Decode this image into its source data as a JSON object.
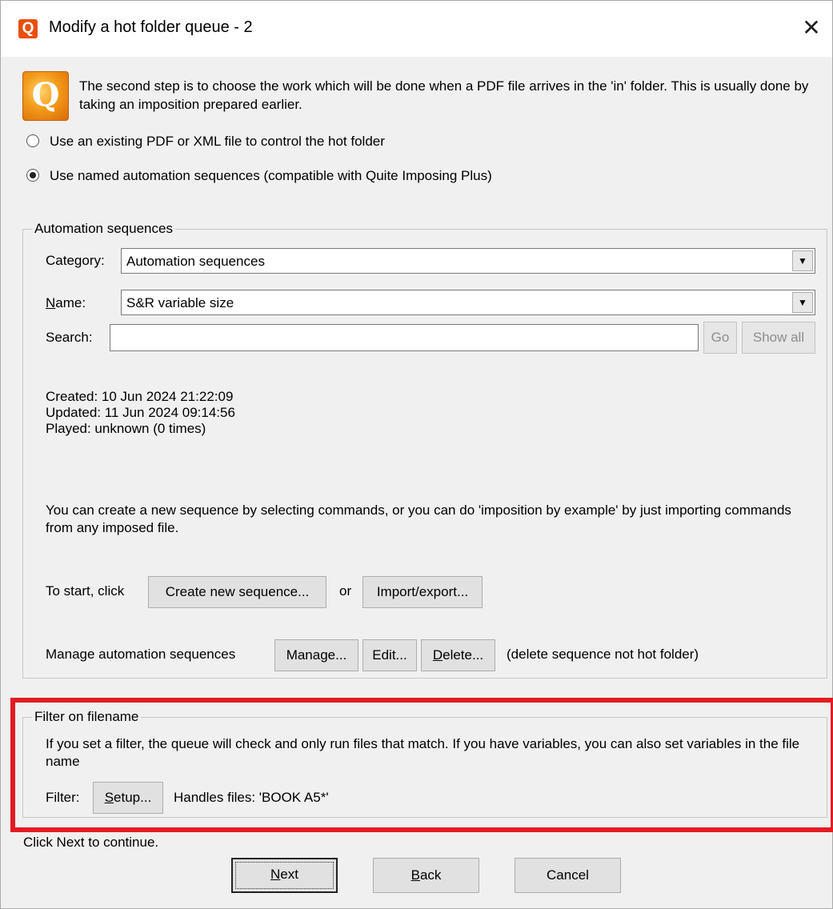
{
  "window": {
    "title": "Modify a hot folder queue - 2",
    "close_glyph": "✕",
    "app_icon_letter": "Q"
  },
  "intro": {
    "big_icon_letter": "Q",
    "text": "The second step is to choose the work which will be done when a PDF file arrives in the 'in' folder. This is usually done by taking an imposition prepared earlier."
  },
  "options": {
    "existing_file": "Use an existing PDF or XML file to control the hot folder",
    "named_sequences": "Use named automation sequences (compatible with Quite Imposing Plus)",
    "selected": "named_sequences"
  },
  "automation": {
    "group_title": "Automation sequences",
    "category_label": "Category:",
    "category_value": "Automation sequences",
    "name_label_first": "N",
    "name_label_rest": "ame:",
    "name_value": "S&R variable size",
    "search_label": "Search:",
    "search_value": "",
    "go_button": "Go",
    "show_all_button": "Show all",
    "created": "Created: 10 Jun 2024 21:22:09",
    "updated": "Updated: 11 Jun 2024 09:14:56",
    "played": "Played: unknown (0 times)",
    "help_text": "You can create a new sequence by selecting commands, or you can do 'imposition by example' by just importing commands from any imposed file.",
    "start_label": "To start, click",
    "create_button": "Create new sequence...",
    "or_label": "or",
    "import_button": "Import/export...",
    "manage_label": "Manage automation sequences",
    "manage_button": "Manage...",
    "edit_button": "Edit...",
    "delete_button_first": "D",
    "delete_button_rest": "elete...",
    "delete_note": "(delete sequence not hot folder)"
  },
  "filter": {
    "group_title": "Filter on filename",
    "description": "If you set a filter, the queue will check and only run files that match. If you have variables, you can also set variables in the file name",
    "filter_label": "Filter:",
    "setup_button_first": "S",
    "setup_button_rest": "etup...",
    "handles_text": "Handles files: 'BOOK A5*'"
  },
  "footer": {
    "continue_text": "Click Next to continue.",
    "next_first": "N",
    "next_rest": "ext",
    "back_first": "B",
    "back_rest": "ack",
    "cancel": "Cancel"
  },
  "colors": {
    "highlight_box": "#e21b23",
    "window_bg": "#f0f0f0",
    "icon_orange": "#e84f0c"
  }
}
